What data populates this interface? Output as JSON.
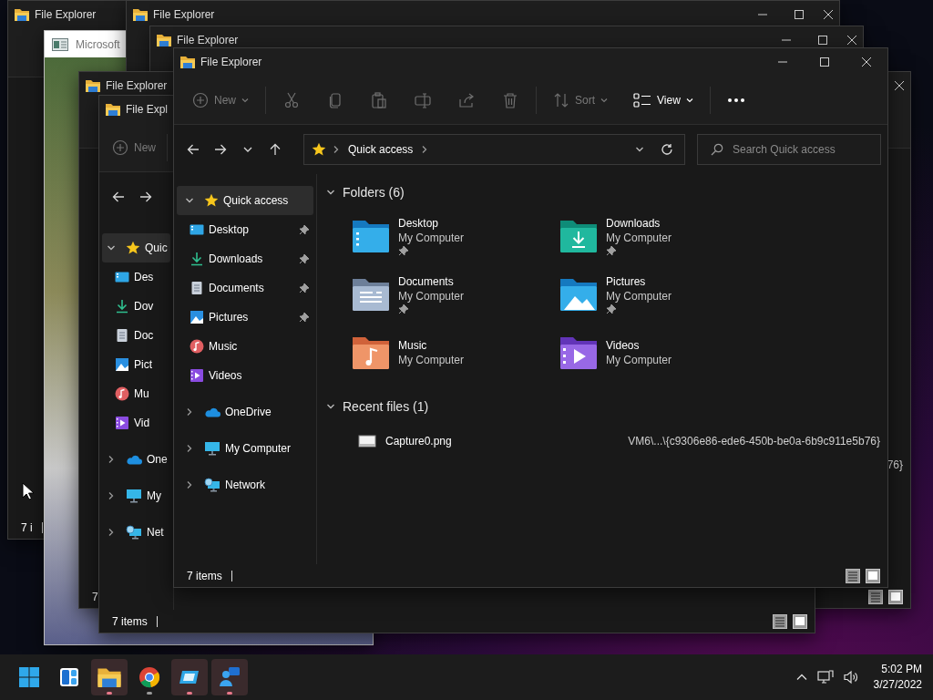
{
  "desktop": {
    "windows": [
      {
        "kind": "explorer",
        "title": "File Explorer",
        "status": "7 i"
      },
      {
        "kind": "app",
        "title": "Microsoft"
      },
      {
        "kind": "explorer",
        "title": "File Explorer"
      },
      {
        "kind": "explorer",
        "title": "File Explorer"
      },
      {
        "kind": "explorer",
        "title": "File Explorer",
        "recent": {
          "items": [
            {
              "path": "76}"
            }
          ]
        },
        "status": "7"
      },
      {
        "kind": "explorer",
        "title": "File Expl",
        "toolbar": [
          {
            "kind": "new",
            "label": "New",
            "disabled": true
          }
        ],
        "nav": [
          {
            "kind": "quick",
            "label": "Quic",
            "expanded": true,
            "selected": true,
            "children": [
              {
                "kind": "desktop",
                "label": "Des",
                "selected": false
              },
              {
                "kind": "downloads",
                "label": "Dov",
                "selected": false
              },
              {
                "kind": "documents",
                "label": "Doc",
                "selected": false
              },
              {
                "kind": "pictures",
                "label": "Pict",
                "selected": false
              },
              {
                "kind": "music",
                "label": "Mu",
                "selected": false
              },
              {
                "kind": "videos",
                "label": "Vid",
                "selected": false
              }
            ]
          },
          {
            "kind": "onedrive",
            "label": "One",
            "expanded": false,
            "selected": false
          },
          {
            "kind": "computer",
            "label": "My",
            "expanded": false,
            "selected": false
          },
          {
            "kind": "network",
            "label": "Net",
            "expanded": false,
            "selected": false
          }
        ],
        "status": "7 items"
      }
    ]
  },
  "window": {
    "title": "File Explorer",
    "toolbar": [
      {
        "kind": "new",
        "label": "New",
        "disabled": true
      },
      {
        "kind": "cut",
        "disabled": true
      },
      {
        "kind": "copy",
        "disabled": true
      },
      {
        "kind": "paste",
        "disabled": true
      },
      {
        "kind": "rename",
        "disabled": true
      },
      {
        "kind": "share",
        "disabled": true
      },
      {
        "kind": "delete",
        "disabled": true
      },
      {
        "kind": "sort",
        "label": "Sort",
        "disabled": true
      },
      {
        "kind": "view",
        "label": "View",
        "disabled": false
      },
      {
        "kind": "more",
        "disabled": false
      }
    ],
    "address": {
      "crumbs": [
        "Quick access"
      ]
    },
    "search": {
      "placeholder": "Search Quick access"
    },
    "nav": [
      {
        "kind": "quick",
        "label": "Quick access",
        "expanded": true,
        "selected": true,
        "children": [
          {
            "kind": "desktop",
            "label": "Desktop",
            "pinned": true,
            "selected": false
          },
          {
            "kind": "downloads",
            "label": "Downloads",
            "pinned": true,
            "selected": false
          },
          {
            "kind": "documents",
            "label": "Documents",
            "pinned": true,
            "selected": false
          },
          {
            "kind": "pictures",
            "label": "Pictures",
            "pinned": true,
            "selected": false
          },
          {
            "kind": "music",
            "label": "Music",
            "pinned": false,
            "selected": false
          },
          {
            "kind": "videos",
            "label": "Videos",
            "pinned": false,
            "selected": false
          }
        ]
      },
      {
        "kind": "onedrive",
        "label": "OneDrive",
        "expanded": false,
        "selected": false
      },
      {
        "kind": "computer",
        "label": "My Computer",
        "expanded": false,
        "selected": false
      },
      {
        "kind": "network",
        "label": "Network",
        "expanded": false,
        "selected": false
      }
    ],
    "folders": {
      "heading": "Folders (6)",
      "expanded": true,
      "items": [
        {
          "kind": "desktop",
          "name": "Desktop",
          "location": "My Computer",
          "pinned": true
        },
        {
          "kind": "downloads",
          "name": "Downloads",
          "location": "My Computer",
          "pinned": true
        },
        {
          "kind": "documents",
          "name": "Documents",
          "location": "My Computer",
          "pinned": true
        },
        {
          "kind": "pictures",
          "name": "Pictures",
          "location": "My Computer",
          "pinned": true
        },
        {
          "kind": "music",
          "name": "Music",
          "location": "My Computer",
          "pinned": false
        },
        {
          "kind": "videos",
          "name": "Videos",
          "location": "My Computer",
          "pinned": false
        }
      ]
    },
    "recent": {
      "heading": "Recent files (1)",
      "expanded": true,
      "items": [
        {
          "name": "Capture0.png",
          "path": "VM6\\...\\{c9306e86-ede6-450b-be0a-6b9c911e5b76}"
        }
      ]
    },
    "status": "7 items"
  },
  "taskbar": {
    "apps": [
      {
        "kind": "start",
        "active": false,
        "running": false
      },
      {
        "kind": "widgets",
        "active": false,
        "running": false
      },
      {
        "kind": "explorer",
        "active": true,
        "running": true
      },
      {
        "kind": "browser",
        "active": false,
        "running": true
      },
      {
        "kind": "remote",
        "active": true,
        "running": true
      },
      {
        "kind": "people",
        "active": true,
        "running": true
      }
    ],
    "time": "5:02 PM",
    "date": "3/27/2022"
  }
}
